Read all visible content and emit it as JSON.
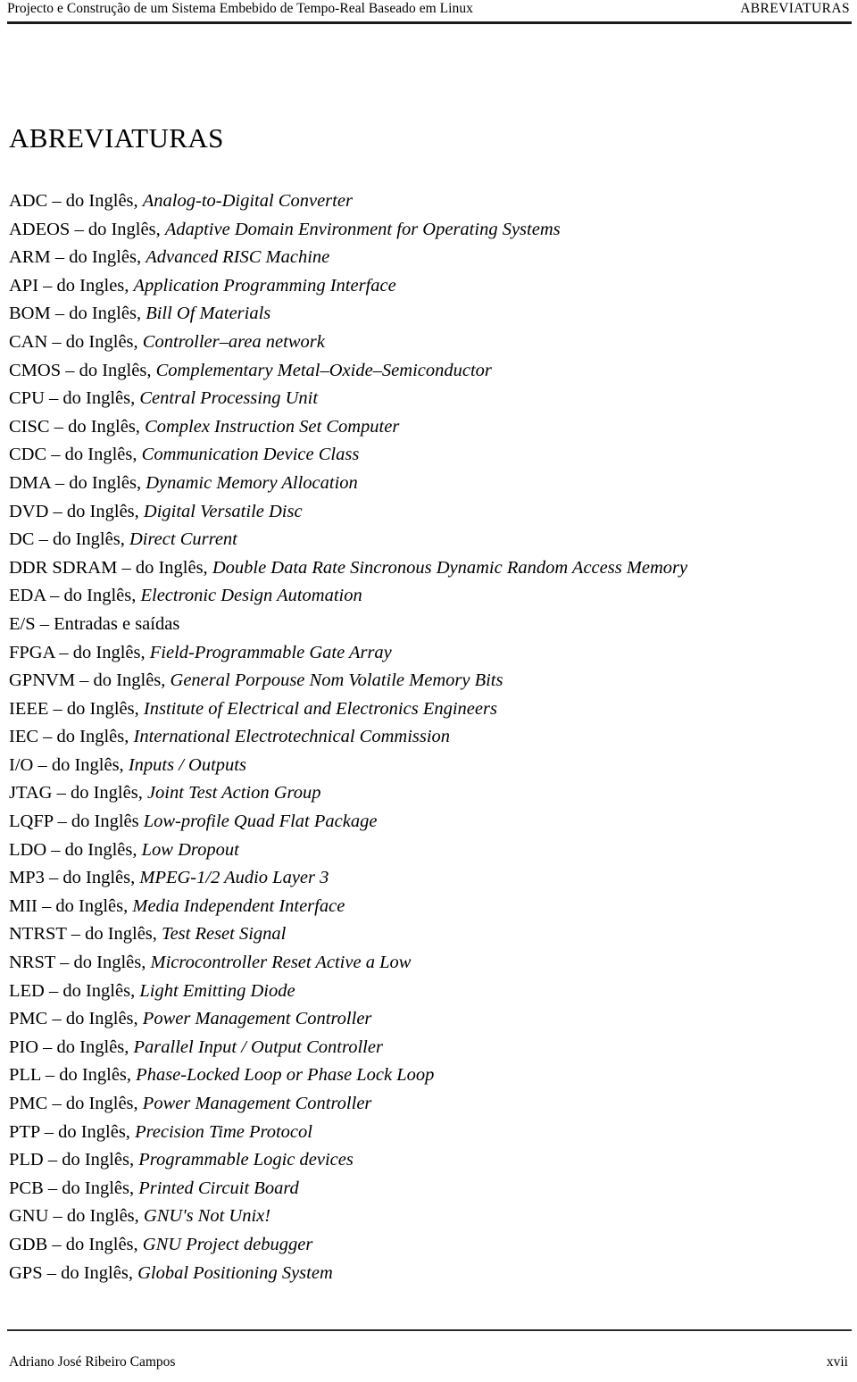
{
  "running_head": {
    "left": "Projecto e Construção de um Sistema Embebido de Tempo-Real Baseado em Linux",
    "right": "ABREVIATURAS"
  },
  "main": {
    "title": "ABREVIATURAS",
    "separator": " – ",
    "source_label": "do Inglês,",
    "entries": [
      {
        "term": "ADC",
        "sep": " – ",
        "source": "do Inglês,",
        "gloss": "Analog-to-Digital Converter",
        "italic": true
      },
      {
        "term": "ADEOS",
        "sep": " – ",
        "source": "do Inglês,",
        "gloss": "Adaptive Domain Environment for Operating Systems",
        "italic": true
      },
      {
        "term": "ARM",
        "sep": " – ",
        "source": "do Inglês,",
        "gloss": "Advanced RISC Machine",
        "italic": true
      },
      {
        "term": "API",
        "sep": " – ",
        "source": "do Ingles,",
        "gloss": "Application Programming Interface",
        "italic": true
      },
      {
        "term": "BOM",
        "sep": " – ",
        "source": "do Inglês,",
        "gloss": "Bill Of Materials",
        "italic": true
      },
      {
        "term": "CAN",
        "sep": " – ",
        "source": "do Inglês,",
        "gloss": "Controller–area network",
        "italic": true
      },
      {
        "term": "CMOS",
        "sep": " – ",
        "source": "do Inglês,",
        "gloss": "Complementary Metal–Oxide–Semiconductor",
        "italic": true
      },
      {
        "term": "CPU",
        "sep": " – ",
        "source": "do Inglês,",
        "gloss": "Central Processing Unit",
        "italic": true
      },
      {
        "term": "CISC",
        "sep": " – ",
        "source": "do Inglês,",
        "gloss": "Complex Instruction Set Computer",
        "italic": true
      },
      {
        "term": "CDC",
        "sep": " – ",
        "source": "do Inglês,",
        "gloss": "Communication Device Class",
        "italic": true
      },
      {
        "term": "DMA",
        "sep": " – ",
        "source": "do Inglês,",
        "gloss": "Dynamic Memory Allocation",
        "italic": true
      },
      {
        "term": "DVD",
        "sep": " – ",
        "source": "do Inglês,",
        "gloss": "Digital Versatile Disc",
        "italic": true
      },
      {
        "term": "DC",
        "sep": " – ",
        "source": "do Inglês,",
        "gloss": "Direct Current",
        "italic": true
      },
      {
        "term": "DDR SDRAM",
        "sep": " – ",
        "source": "do Inglês,",
        "gloss": "Double Data Rate Sincronous Dynamic Random Access Memory",
        "italic": true
      },
      {
        "term": "EDA",
        "sep": " – ",
        "source": "do Inglês,",
        "gloss": "Electronic Design Automation",
        "italic": true
      },
      {
        "term": "E/S",
        "sep": " – ",
        "source": "",
        "gloss": "Entradas e saídas",
        "italic": false
      },
      {
        "term": "FPGA",
        "sep": " – ",
        "source": "do Inglês,",
        "gloss": "Field-Programmable Gate Array",
        "italic": true
      },
      {
        "term": "GPNVM",
        "sep": " – ",
        "source": "do Inglês,",
        "gloss": "General Porpouse Nom Volatile Memory Bits",
        "italic": true
      },
      {
        "term": "IEEE",
        "sep": " – ",
        "source": "do Inglês,",
        "gloss": "Institute of Electrical and Electronics Engineers",
        "italic": true
      },
      {
        "term": "IEC",
        "sep": " – ",
        "source": "do Inglês,",
        "gloss": "International Electrotechnical Commission",
        "italic": true
      },
      {
        "term": "I/O",
        "sep": " – ",
        "source": "do Inglês,",
        "gloss": "Inputs / Outputs",
        "italic": true
      },
      {
        "term": "JTAG",
        "sep": " – ",
        "source": "do Inglês,",
        "gloss": "Joint Test Action Group",
        "italic": true
      },
      {
        "term": "LQFP",
        "sep": " – ",
        "source": "do Inglês",
        "gloss": "Low-profile Quad Flat Package",
        "italic": true
      },
      {
        "term": "LDO",
        "sep": " – ",
        "source": "do Inglês,",
        "gloss": "Low Dropout",
        "italic": true
      },
      {
        "term": "MP3",
        "sep": " – ",
        "source": "do Inglês,",
        "gloss": "MPEG-1/2 Audio Layer 3",
        "italic": true
      },
      {
        "term": "MII",
        "sep": " – ",
        "source": "do Inglês,",
        "gloss": "Media Independent Interface",
        "italic": true
      },
      {
        "term": "NTRST",
        "sep": " – ",
        "source": "do Inglês,",
        "gloss": "Test Reset Signal",
        "italic": true
      },
      {
        "term": "NRST",
        "sep": " – ",
        "source": "do Inglês,",
        "gloss": "Microcontroller Reset Active a Low",
        "italic": true
      },
      {
        "term": "LED",
        "sep": " – ",
        "source": "do Inglês,",
        "gloss": "Light Emitting Diode",
        "italic": true
      },
      {
        "term": "PMC",
        "sep": " – ",
        "source": "do Inglês,",
        "gloss": "Power Management Controller",
        "italic": true
      },
      {
        "term": "PIO",
        "sep": " – ",
        "source": "do Inglês,",
        "gloss": "Parallel Input / Output Controller",
        "italic": true
      },
      {
        "term": "PLL",
        "sep": " – ",
        "source": "do Inglês,",
        "gloss": "Phase-Locked Loop or Phase Lock Loop",
        "italic": true
      },
      {
        "term": "PMC",
        "sep": " – ",
        "source": "do Inglês,",
        "gloss": "Power Management Controller",
        "italic": true
      },
      {
        "term": "PTP",
        "sep": " – ",
        "source": "do Inglês,",
        "gloss": "Precision Time Protocol",
        "italic": true
      },
      {
        "term": "PLD",
        "sep": " – ",
        "source": "do Inglês,",
        "gloss": "Programmable Logic devices",
        "italic": true
      },
      {
        "term": "PCB",
        "sep": " – ",
        "source": "do Inglês,",
        "gloss": "Printed Circuit Board",
        "italic": true
      },
      {
        "term": "GNU",
        "sep": " – ",
        "source": "do Inglês,",
        "gloss": "GNU's Not Unix!",
        "italic": true
      },
      {
        "term": "GDB",
        "sep": " – ",
        "source": "do Inglês,",
        "gloss": "GNU Project debugger",
        "italic": true
      },
      {
        "term": "GPS",
        "sep": " – ",
        "source": "do Inglês,",
        "gloss": "Global Positioning System",
        "italic": true
      }
    ]
  },
  "footer": {
    "author": "Adriano José Ribeiro Campos",
    "page_number": "xvii"
  },
  "colors": {
    "text": "#000000",
    "rule": "#1a1a1a",
    "background": "#ffffff"
  }
}
